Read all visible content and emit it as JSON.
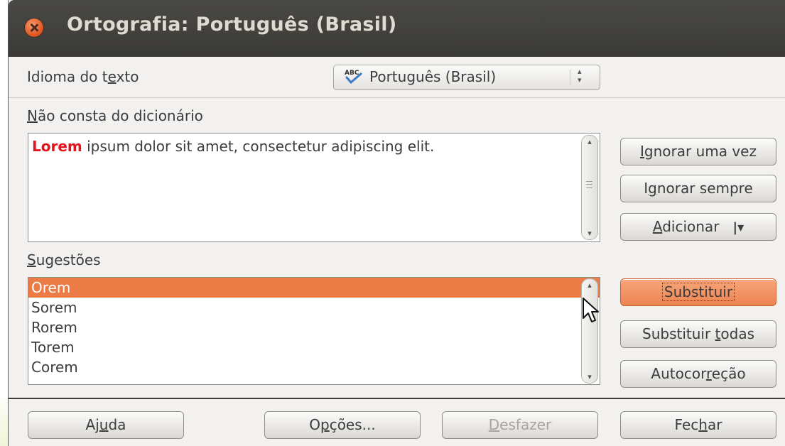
{
  "window": {
    "title": "Ortografia: Português (Brasil)"
  },
  "language": {
    "label": "Idioma do texto",
    "label_underline_char": "e",
    "selected": "Português (Brasil)",
    "icon": "abc-spellcheck-icon"
  },
  "not_in_dictionary": {
    "label": "Não consta do dicionário",
    "error_word": "Lorem",
    "text_rest": " ipsum dolor sit amet, consectetur adipiscing elit."
  },
  "suggestions": {
    "label": "Sugestões",
    "items": [
      "Orem",
      "Sorem",
      "Rorem",
      "Torem",
      "Corem"
    ],
    "selected_index": 0
  },
  "buttons": {
    "ignore_once": "Ignorar uma vez",
    "ignore_always": "Ignorar sempre",
    "add": "Adicionar",
    "replace": "Substituir",
    "replace_all": "Substituir todas",
    "autocorrect": "Autocorreção",
    "help": "Ajuda",
    "options": "Opções...",
    "undo": "Desfazer",
    "close": "Fechar"
  },
  "colors": {
    "error_word": "#e3141d",
    "selection": "#eb7c46",
    "titlebar": "#3f3e3a",
    "close_button": "#e15b26"
  }
}
